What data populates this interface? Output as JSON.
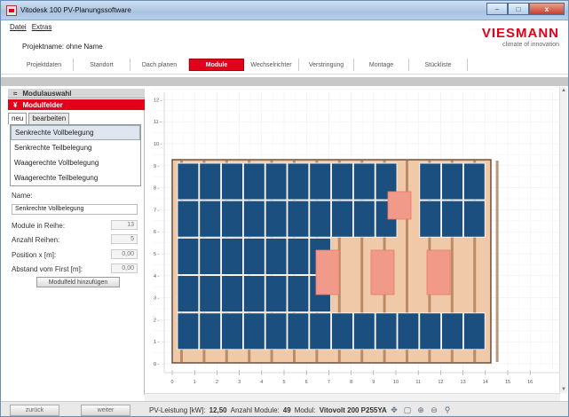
{
  "window": {
    "title": "Vitodesk 100 PV-Planungssoftware",
    "min": "–",
    "max": "□",
    "close": "x"
  },
  "menu": [
    "Datei",
    "Extras"
  ],
  "project": {
    "label": "Projektname: ohne Name"
  },
  "brand": {
    "name": "VIESMANN",
    "tagline": "climate of innovation",
    "color": "#e2001a"
  },
  "tabs": [
    "Projektdaten",
    "Standort",
    "Dach planen",
    "Module",
    "Wechselrichter",
    "Verstringung",
    "Montage",
    "Stückliste"
  ],
  "active_tab": "Module",
  "panel": {
    "section1": {
      "icon": "≈",
      "label": "Modulauswahl"
    },
    "section2": {
      "icon": "¥",
      "label": "Modulfelder"
    },
    "subtabs": [
      "neu",
      "bearbeiten"
    ],
    "list": [
      "Senkrechte Vollbelegung",
      "Senkrechte Teilbelegung",
      "Waagerechte Vollbelegung",
      "Waagerechte Teilbelegung"
    ],
    "name_label": "Name:",
    "name_value": "Senkrechte Vollbelegung",
    "fields": [
      {
        "label": "Module in Reihe:",
        "value": "13"
      },
      {
        "label": "Anzahl Reihen:",
        "value": "5"
      },
      {
        "label": "Position x [m]:",
        "value": "0,00"
      },
      {
        "label": "Abstand vom First [m]:",
        "value": "0,00"
      }
    ],
    "add_button": "Modulfeld hinzufügen"
  },
  "plan": {
    "y_ticks": [
      "0",
      "1",
      "2",
      "3",
      "4",
      "5",
      "6",
      "7",
      "8",
      "9",
      "10",
      "11",
      "12"
    ],
    "x_ticks": [
      "0",
      "1",
      "2",
      "3",
      "4",
      "5",
      "6",
      "7",
      "8",
      "9",
      "10",
      "11",
      "12",
      "13",
      "14",
      "15",
      "16"
    ],
    "module_color": "#1b4f7f",
    "roof_color": "#f0c9a9",
    "obstacle_color": "#f29a8a"
  },
  "scroll": {
    "up": "▲",
    "down": "▼",
    "left": "◄",
    "right": "►"
  },
  "footer": {
    "back": "zurück",
    "next": "weiter",
    "pv_label": "PV-Leistung [kW]:",
    "pv_value": "12,50",
    "count_label": "Anzahl Module:",
    "count_value": "49",
    "module_label": "Modul:",
    "module_value": "Vitovolt 200 P255YA",
    "tools": [
      "✥",
      "▢",
      "⊕",
      "⊖",
      "⚲"
    ]
  }
}
